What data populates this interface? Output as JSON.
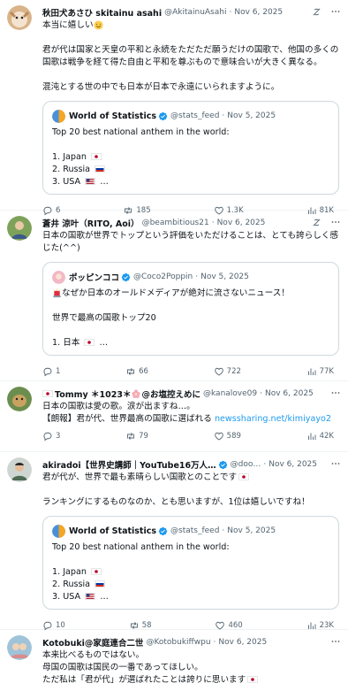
{
  "colors": {
    "accent": "#1d9bf0",
    "muted": "#536471",
    "text": "#0f1419",
    "verified": "#1d9bf0"
  },
  "posts": [
    {
      "name": "秋田犬あさひ skitainu asahi",
      "handle": "@AkitainuAsahi",
      "date": "Nov 6, 2025",
      "text_lines": [
        "本当に嬉しい",
        "",
        "君が代は国家と天皇の平和と永続をただただ願うだけの国歌で、他国の多くの国歌は戦争を経て得た自由と平和を尊ぶもので意味合いが大きく異なる。",
        "",
        "混沌とする世の中でも日本が日本で永遠にいられますように。"
      ],
      "quote": {
        "name": "World of Statistics",
        "handle": "@stats_feed",
        "date": "Nov 5, 2025",
        "lines": [
          "Top 20 best national anthem in the world:",
          "",
          "1. Japan",
          "2. Russia",
          "3. USA"
        ]
      },
      "stats": {
        "replies": "6",
        "reposts": "185",
        "likes": "1.3K",
        "views": "81K"
      }
    },
    {
      "name": "蒼井 涼叶（RITO, Aoi）",
      "handle": "@beambitious21",
      "date": "Nov 6, 2025",
      "text_lines": [
        "日本の国歌が世界でトップという評価をいただけることは、とても誇らしく感じた(^^)"
      ],
      "quote": {
        "name": "ポッピンココ",
        "handle": "@Coco2Poppin",
        "date": "Nov 5, 2025",
        "lines": [
          "なぜか日本のオールドメディアが絶対に流さないニュース！",
          "",
          "世界で最高の国歌トップ20",
          "",
          "1. 日本"
        ]
      },
      "stats": {
        "replies": "1",
        "reposts": "66",
        "likes": "722",
        "views": "77K"
      }
    },
    {
      "name": "Tommy ＊1023＊",
      "name_suffix": "@お塩控えめに",
      "handle": "@kanalove09",
      "date": "Nov 6, 2025",
      "text_lines": [
        "日本の国歌は愛の歌。涙が出ますね…。"
      ],
      "text_prefix": "【朗報】君が代、世界最高の国歌に選ばれる",
      "link": "newssharing.net/kimiyayo2",
      "stats": {
        "replies": "3",
        "reposts": "79",
        "likes": "589",
        "views": "42K"
      }
    },
    {
      "name": "akiradoi【世界史講師｜YouTube16万人…",
      "handle": "@doo…",
      "date": "Nov 6, 2025",
      "text_lines": [
        "君が代が、世界で最も素晴らしい国歌とのことです",
        "",
        "ランキングにするものなのか、とも思いますが、1位は嬉しいですね！"
      ],
      "quote": {
        "name": "World of Statistics",
        "handle": "@stats_feed",
        "date": "Nov 5, 2025",
        "lines": [
          "Top 20 best national anthem in the world:",
          "",
          "1. Japan",
          "2. Russia",
          "3. USA"
        ]
      },
      "stats": {
        "replies": "10",
        "reposts": "58",
        "likes": "460",
        "views": "23K"
      }
    },
    {
      "name": "Kotobuki@家庭連合二世",
      "handle": "@Kotobukiffwpu",
      "date": "Nov 6, 2025",
      "text_lines": [
        "本来比べるものではない。",
        "母国の国歌は国民の一番であってほしい。",
        "ただ私は「君が代」が選ばれたことは誇りに思います"
      ]
    }
  ],
  "ellipsis": "…",
  "sep": "·",
  "icons": [
    "grok-icon",
    "more-icon",
    "reply-icon",
    "repost-icon",
    "like-icon",
    "views-icon",
    "verified-icon",
    "flag-japan-icon",
    "flag-russia-icon",
    "flag-usa-icon"
  ]
}
